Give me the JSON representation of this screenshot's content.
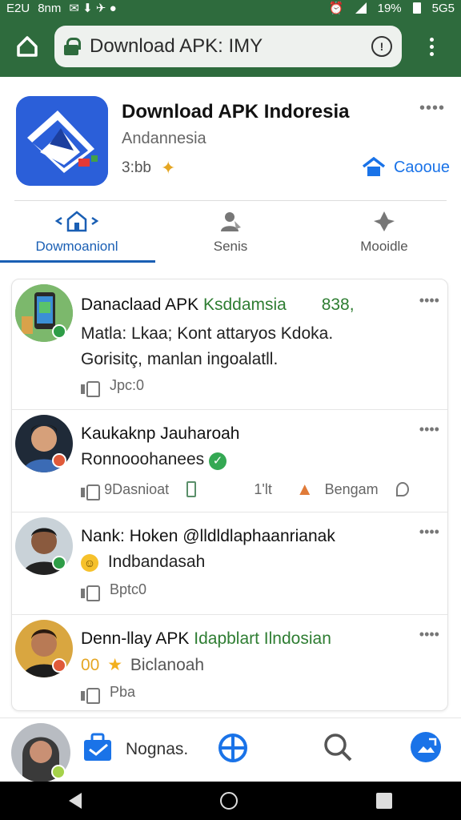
{
  "status_bar": {
    "left_text": "E2U",
    "left_text2": "8nm",
    "battery_percent": "19%",
    "right_text": "5G5"
  },
  "browser": {
    "url": "Download APK: IMY"
  },
  "app": {
    "title": "Download APK Indoresia",
    "subtitle": "Andannesia",
    "meta": "3:bb",
    "action_label": "Caooue",
    "more": "••••"
  },
  "tabs": [
    {
      "label": "Dowmoanionl"
    },
    {
      "label": "Senis"
    },
    {
      "label": "Mooidle"
    }
  ],
  "posts": [
    {
      "name": "Danaclaad APK",
      "name_green": "Ksddamsia",
      "count": "838,",
      "line1": "Matla: Lkaa; Kont attaryos Kdoka.",
      "line2": "Gorisitç, manlan ingoalatll.",
      "action1": "Jpc:0",
      "more": "••••"
    },
    {
      "name": "Kaukaknp Jauharoah",
      "sub": "Ronnooohanees",
      "action1": "9Dasnioat",
      "action2": "1'lt",
      "action3": "Bengam",
      "more": "••••"
    },
    {
      "name": "Nank: Hoken @lldldlaphaanrianak",
      "sub": "Indbandasah",
      "action1": "Bptc0",
      "more": "••••"
    },
    {
      "name": "Denn-llay APK",
      "name_green": "Idapblart Ilndosian",
      "sub_prefix": "00",
      "sub": "Biclanoah",
      "action1": "Pba",
      "more": "••••"
    }
  ],
  "dock": {
    "label": "Nognas."
  },
  "colors": {
    "brand_green": "#2e6b3d",
    "accent_blue": "#1a73e8",
    "tab_blue": "#1a5fb4",
    "verified_green": "#2e7d32"
  }
}
